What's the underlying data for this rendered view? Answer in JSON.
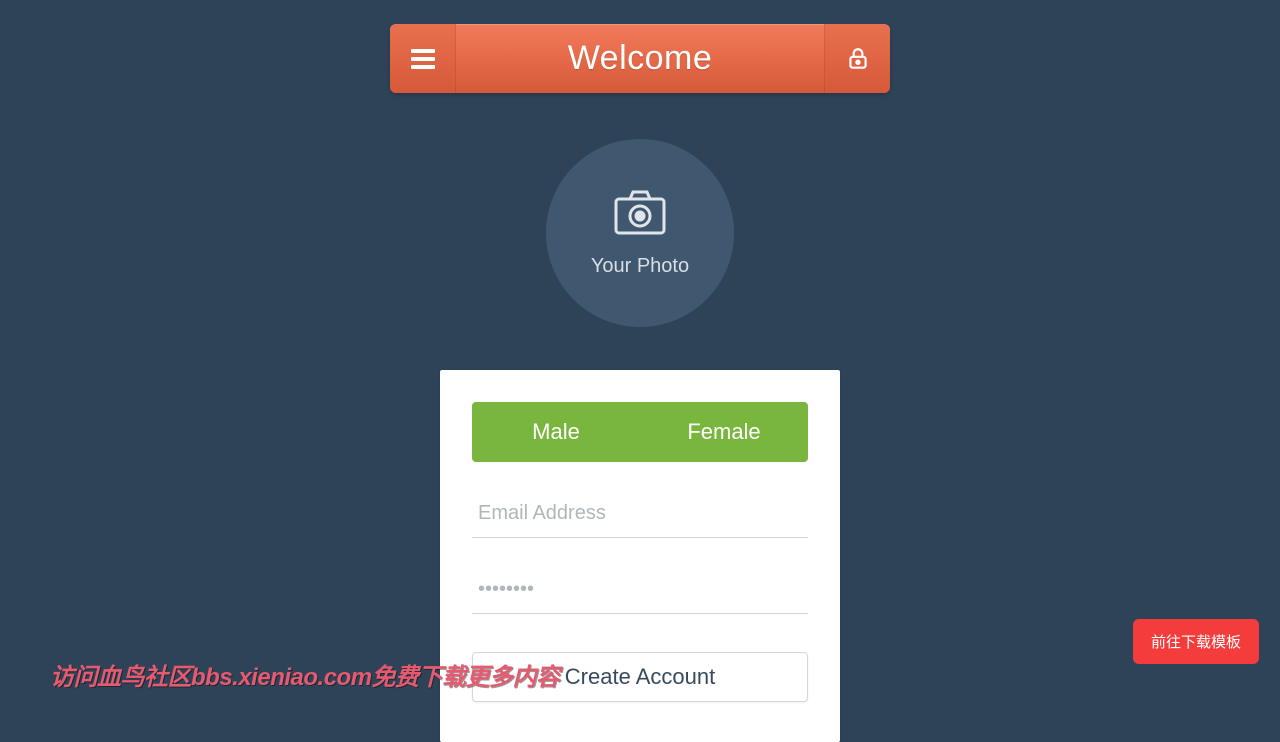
{
  "header": {
    "title": "Welcome"
  },
  "photo": {
    "label": "Your Photo"
  },
  "form": {
    "gender": {
      "male": "Male",
      "female": "Female"
    },
    "email_placeholder": "Email Address",
    "email_value": "",
    "password_placeholder": "••••••••",
    "password_value": "",
    "submit_label": "Create Account"
  },
  "watermark": "访问血鸟社区bbs.xieniao.com免费下载更多内容",
  "badge": {
    "label": "前往下载模板"
  }
}
